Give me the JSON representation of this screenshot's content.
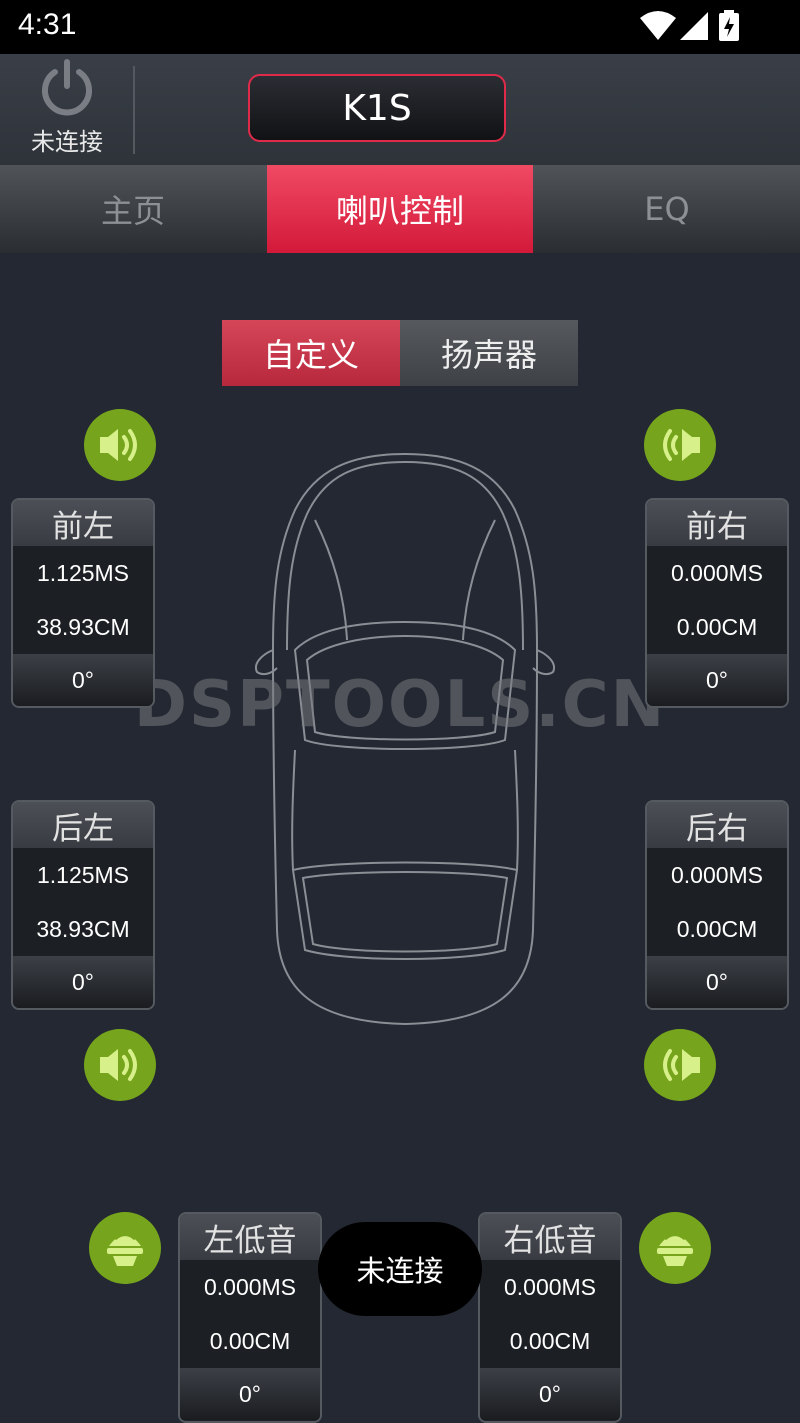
{
  "status_bar": {
    "time": "4:31"
  },
  "header": {
    "connection_label": "未连接",
    "device_name": "K1S"
  },
  "tabs": [
    {
      "label": "主页",
      "active": false
    },
    {
      "label": "喇叭控制",
      "active": true
    },
    {
      "label": "EQ",
      "active": false
    }
  ],
  "mode_toggle": {
    "selected": "自定义",
    "other": "扬声器"
  },
  "channels": {
    "front_left": {
      "name": "前左",
      "delay": "1.125MS",
      "distance": "38.93CM",
      "phase": "0°"
    },
    "front_right": {
      "name": "前右",
      "delay": "0.000MS",
      "distance": "0.00CM",
      "phase": "0°"
    },
    "rear_left": {
      "name": "后左",
      "delay": "1.125MS",
      "distance": "38.93CM",
      "phase": "0°"
    },
    "rear_right": {
      "name": "后右",
      "delay": "0.000MS",
      "distance": "0.00CM",
      "phase": "0°"
    },
    "sub_left": {
      "name": "左低音",
      "delay": "0.000MS",
      "distance": "0.00CM",
      "phase": "0°"
    },
    "sub_right": {
      "name": "右低音",
      "delay": "0.000MS",
      "distance": "0.00CM",
      "phase": "0°"
    }
  },
  "watermark": "DSPTOOLS.CN",
  "toast": "未连接",
  "colors": {
    "accent": "#d9203f",
    "speaker_active": "#76a51d",
    "background": "#232832"
  },
  "icons": {
    "power": "power-icon",
    "speaker": "speaker-icon",
    "subwoofer": "subwoofer-icon",
    "car": "car-outline"
  }
}
